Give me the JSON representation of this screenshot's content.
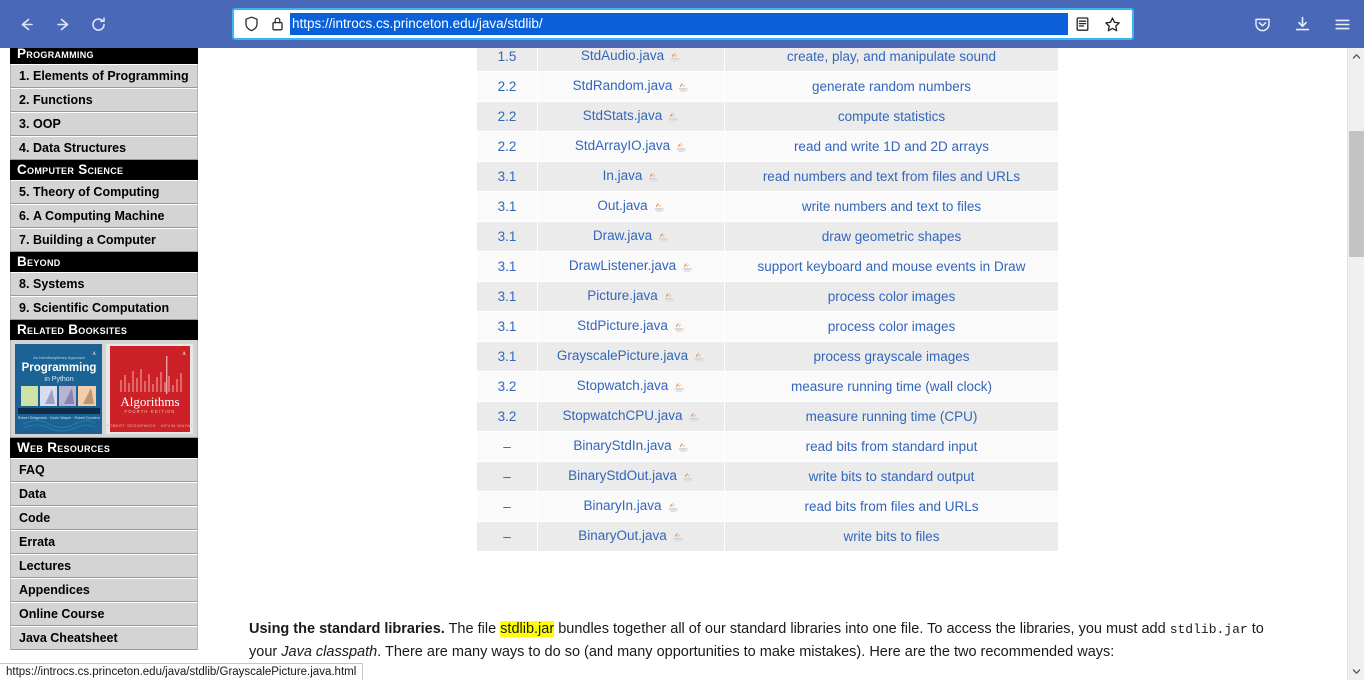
{
  "browser": {
    "back_label": "Back",
    "forward_label": "Forward",
    "reload_label": "Reload",
    "url": "https://introcs.cs.princeton.edu/java/stdlib/",
    "url_selected": true,
    "shield_icon": "shield-icon",
    "lock_icon": "lock-icon",
    "reader_icon": "reader-view-icon",
    "bookmark_icon": "star-bookmark-icon",
    "pocket_icon": "pocket-icon",
    "downloads_icon": "downloads-icon",
    "menu_icon": "hamburger-menu-icon",
    "toolbar_color": "#4a68b8",
    "url_highlight_color": "#0a60d8",
    "focus_border_color": "#3ab6f5"
  },
  "status_bar": {
    "text": "https://introcs.cs.princeton.edu/java/stdlib/GrayscalePicture.java.html"
  },
  "sidebar": {
    "sections": [
      {
        "header": "Programming",
        "items": [
          {
            "num": "1.",
            "label": "Elements of Programming"
          },
          {
            "num": "2.",
            "label": "Functions"
          },
          {
            "num": "3.",
            "label": "OOP"
          },
          {
            "num": "4.",
            "label": "Data Structures"
          }
        ]
      },
      {
        "header": "Computer Science",
        "items": [
          {
            "num": "5.",
            "label": "Theory of Computing"
          },
          {
            "num": "6.",
            "label": "A Computing Machine"
          },
          {
            "num": "7.",
            "label": "Building a Computer"
          }
        ]
      },
      {
        "header": "Beyond",
        "items": [
          {
            "num": "8.",
            "label": "Systems"
          },
          {
            "num": "9.",
            "label": "Scientific Computation"
          }
        ]
      },
      {
        "header": "Related Booksites",
        "items": []
      },
      {
        "header": "Web Resources",
        "items": [
          {
            "num": "",
            "label": "FAQ"
          },
          {
            "num": "",
            "label": "Data"
          },
          {
            "num": "",
            "label": "Code"
          },
          {
            "num": "",
            "label": "Errata"
          },
          {
            "num": "",
            "label": "Lectures"
          },
          {
            "num": "",
            "label": "Appendices"
          },
          {
            "num": "",
            "label": "Online Course"
          },
          {
            "num": "",
            "label": "Java Cheatsheet"
          }
        ]
      }
    ],
    "booksites": [
      {
        "name": "programming-in-python-book-cover",
        "title": "Programming",
        "subtitle": "in Python",
        "color": "#1f5f94"
      },
      {
        "name": "algorithms-book-cover",
        "title": "Algorithms",
        "subtitle": "FOURTH EDITION",
        "color": "#cc2127"
      }
    ]
  },
  "table": {
    "link_color": "#3366bb",
    "rows": [
      {
        "section": "1.5",
        "file": "StdAudio.java",
        "desc": "create, play, and manipulate sound"
      },
      {
        "section": "2.2",
        "file": "StdRandom.java",
        "desc": "generate random numbers"
      },
      {
        "section": "2.2",
        "file": "StdStats.java",
        "desc": "compute statistics"
      },
      {
        "section": "2.2",
        "file": "StdArrayIO.java",
        "desc": "read and write 1D and 2D arrays"
      },
      {
        "section": "3.1",
        "file": "In.java",
        "desc": "read numbers and text from files and URLs"
      },
      {
        "section": "3.1",
        "file": "Out.java",
        "desc": "write numbers and text to files"
      },
      {
        "section": "3.1",
        "file": "Draw.java",
        "desc": "draw geometric shapes"
      },
      {
        "section": "3.1",
        "file": "DrawListener.java",
        "desc": "support keyboard and mouse events in Draw"
      },
      {
        "section": "3.1",
        "file": "Picture.java",
        "desc": "process color images"
      },
      {
        "section": "3.1",
        "file": "StdPicture.java",
        "desc": "process color images"
      },
      {
        "section": "3.1",
        "file": "GrayscalePicture.java",
        "desc": "process grayscale images"
      },
      {
        "section": "3.2",
        "file": "Stopwatch.java",
        "desc": "measure running time (wall clock)"
      },
      {
        "section": "3.2",
        "file": "StopwatchCPU.java",
        "desc": "measure running time (CPU)"
      },
      {
        "section": "–",
        "file": "BinaryStdIn.java",
        "desc": "read bits from standard input"
      },
      {
        "section": "–",
        "file": "BinaryStdOut.java",
        "desc": "write bits to standard output"
      },
      {
        "section": "–",
        "file": "BinaryIn.java",
        "desc": "read bits from files and URLs"
      },
      {
        "section": "–",
        "file": "BinaryOut.java",
        "desc": "write bits to files"
      }
    ]
  },
  "paragraph": {
    "lead": "Using the standard libraries.",
    "t1": " The file ",
    "link_highlighted": "stdlib.jar",
    "t2": " bundles together all of our standard libraries into one file. To access the libraries, you must add ",
    "code1": "stdlib.jar",
    "t3": " to your ",
    "italic1": "Java classpath",
    "t4": ". There are many ways to do so (and many opportunities to make mistakes). Here are the two recommended ways:"
  }
}
